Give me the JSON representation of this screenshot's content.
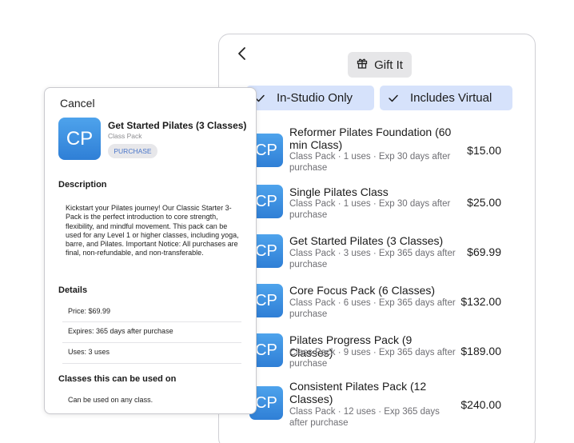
{
  "list_panel": {
    "gift_label": "Gift It",
    "gift_icon": "gift-icon",
    "filters": [
      {
        "label": "In-Studio Only",
        "checked": true
      },
      {
        "label": "Includes Virtual",
        "checked": true
      }
    ],
    "packs": [
      {
        "avatar": "CP",
        "name": "Reformer Pilates Foundation (60 min Class)",
        "sub": "Class Pack · 1 uses · Exp 30 days after purchase",
        "price": "$15.00"
      },
      {
        "avatar": "CP",
        "name": "Single Pilates Class",
        "sub": "Class Pack · 1 uses · Exp 30 days after purchase",
        "price": "$25.00"
      },
      {
        "avatar": "CP",
        "name": "Get Started Pilates (3 Classes)",
        "sub": "Class Pack · 3 uses · Exp 365 days after purchase",
        "price": "$69.99"
      },
      {
        "avatar": "CP",
        "name": "Core Focus Pack (6 Classes)",
        "sub": "Class Pack · 6 uses · Exp 365 days after purchase",
        "price": "$132.00"
      },
      {
        "avatar": "CP",
        "name": "Pilates Progress Pack (9 Classes)",
        "sub": "Class Pack · 9 uses · Exp 365 days after purchase",
        "price": "$189.00"
      },
      {
        "avatar": "CP",
        "name": "Consistent Pilates Pack (12 Classes)",
        "sub": "Class Pack · 12 uses · Exp 365 days after purchase",
        "price": "$240.00"
      }
    ]
  },
  "detail_panel": {
    "cancel_label": "Cancel",
    "avatar": "CP",
    "title": "Get Started Pilates (3 Classes)",
    "type": "Class Pack",
    "purchase_label": "PURCHASE",
    "description_heading": "Description",
    "description": "Kickstart your Pilates journey! Our Classic Starter 3-Pack is the perfect introduction to core strength, flexibility, and mindful movement. This pack can be used for any Level 1 or higher classes, including yoga, barre, and Pilates. Important Notice: All purchases are final, non-refundable, and non-transferable.",
    "details_heading": "Details",
    "details": {
      "price": "Price: $69.99",
      "expires": "Expires: 365 days after purchase",
      "uses": "Uses: 3 uses"
    },
    "classes_heading": "Classes this can be used on",
    "classes_text": "Can be used on any class."
  },
  "colors": {
    "accent": "#4a76c9",
    "filter_bg": "#d6e2fb",
    "avatar_gradient_top": "#4ea3ec",
    "avatar_gradient_bottom": "#2f7fd6"
  }
}
